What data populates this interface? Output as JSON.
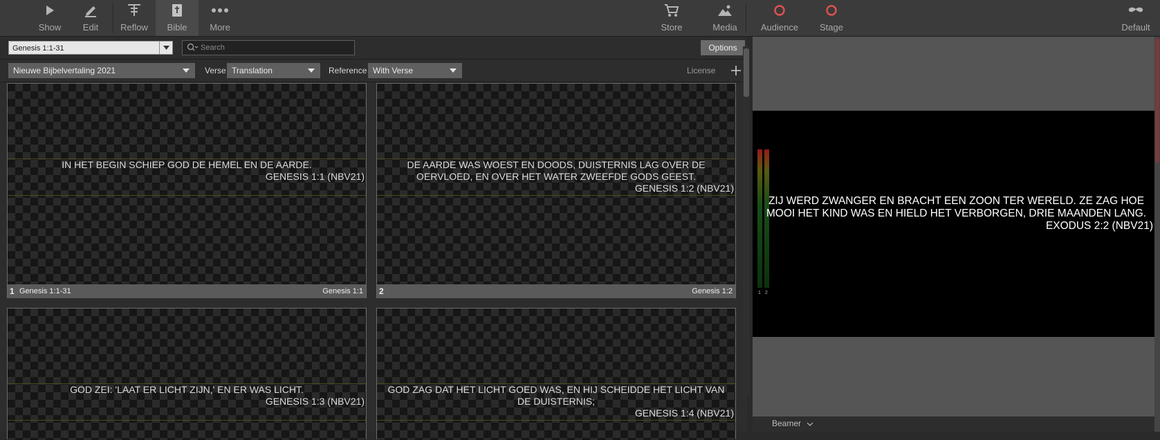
{
  "toolbar": {
    "show": "Show",
    "edit": "Edit",
    "reflow": "Reflow",
    "bible": "Bible",
    "more": "More",
    "store": "Store",
    "media": "Media",
    "audience": "Audience",
    "stage": "Stage",
    "default": "Default"
  },
  "colors": {
    "accent_red": "#e0524f",
    "toolbar_bg": "#3b3b3b"
  },
  "controls": {
    "passage_value": "Genesis 1:1-31",
    "search_placeholder": "Search",
    "options_label": "Options",
    "translation_value": "Nieuwe Bijbelvertaling 2021",
    "verse_label": "Verse",
    "verse_value": "Translation",
    "reference_label": "Reference",
    "reference_value": "With Verse",
    "license_label": "License"
  },
  "slides": [
    {
      "number": "1",
      "text": "IN HET BEGIN SCHIEP GOD DE HEMEL EN DE AARDE.",
      "reference": "GENESIS 1:1 (NBV21)",
      "footer_name": "Genesis 1:1-31",
      "footer_verse": "Genesis 1:1"
    },
    {
      "number": "2",
      "text": "DE AARDE WAS WOEST EN DOODS, DUISTERNIS LAG OVER DE OERVLOED, EN OVER HET WATER ZWEEFDE GODS GEEST.",
      "reference": "GENESIS 1:2 (NBV21)",
      "footer_name": "",
      "footer_verse": "Genesis 1:2"
    },
    {
      "number": "",
      "text": "GOD ZEI: 'LAAT ER LICHT ZIJN,' EN ER WAS LICHT.",
      "reference": "GENESIS 1:3 (NBV21)",
      "footer_name": "",
      "footer_verse": ""
    },
    {
      "number": "",
      "text": "GOD ZAG DAT HET LICHT GOED WAS, EN HIJ SCHEIDDE HET LICHT VAN DE DUISTERNIS;",
      "reference": "GENESIS 1:4 (NBV21)",
      "footer_name": "",
      "footer_verse": ""
    }
  ],
  "output": {
    "text": "ZIJ WERD ZWANGER EN BRACHT EEN ZOON TER WERELD. ZE ZAG HOE MOOI HET KIND WAS EN HIELD HET VERBORGEN, DRIE MAANDEN LANG.",
    "reference": "EXODUS 2:2 (NBV21)",
    "meter_left": "1",
    "meter_right": "2",
    "screen_label": "Beamer"
  }
}
